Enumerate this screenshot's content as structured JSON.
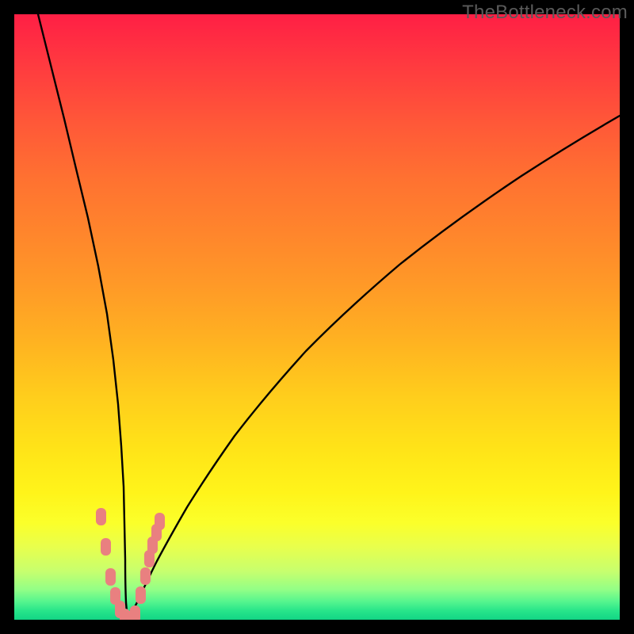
{
  "watermark": "TheBottleneck.com",
  "chart_data": {
    "type": "line",
    "title": "",
    "xlabel": "",
    "ylabel": "",
    "xlim": [
      0,
      100
    ],
    "ylim": [
      0,
      100
    ],
    "series": [
      {
        "name": "bottleneck-curve",
        "x": [
          4,
          5,
          6,
          7,
          8,
          9,
          10,
          11,
          12,
          13,
          14,
          15,
          16,
          17,
          18,
          19,
          20,
          21,
          22,
          24,
          26,
          28,
          30,
          33,
          36,
          40,
          45,
          50,
          56,
          63,
          71,
          80,
          90,
          100
        ],
        "y": [
          100,
          92,
          84,
          77,
          69,
          62,
          54,
          46,
          38,
          30,
          22,
          14,
          7,
          2,
          0,
          2,
          6,
          10,
          14,
          21,
          28,
          33,
          38,
          45,
          50,
          56,
          62,
          67,
          72,
          76,
          80,
          84,
          87,
          90
        ]
      }
    ],
    "markers": {
      "name": "highlight-dots",
      "x": [
        13.5,
        14.3,
        15.2,
        15.8,
        16.4,
        17.0,
        17.6,
        18.4,
        19.3,
        20.0,
        20.6,
        21.2,
        21.8,
        22.3
      ],
      "y": [
        17,
        12,
        7,
        4,
        2,
        1,
        1,
        2,
        5,
        8,
        11,
        13,
        15,
        17
      ]
    },
    "gradient_bands": [
      {
        "pos": 0.0,
        "color": "#ff1f45"
      },
      {
        "pos": 0.5,
        "color": "#ffad24"
      },
      {
        "pos": 0.82,
        "color": "#fff41a"
      },
      {
        "pos": 1.0,
        "color": "#12d585"
      }
    ]
  }
}
